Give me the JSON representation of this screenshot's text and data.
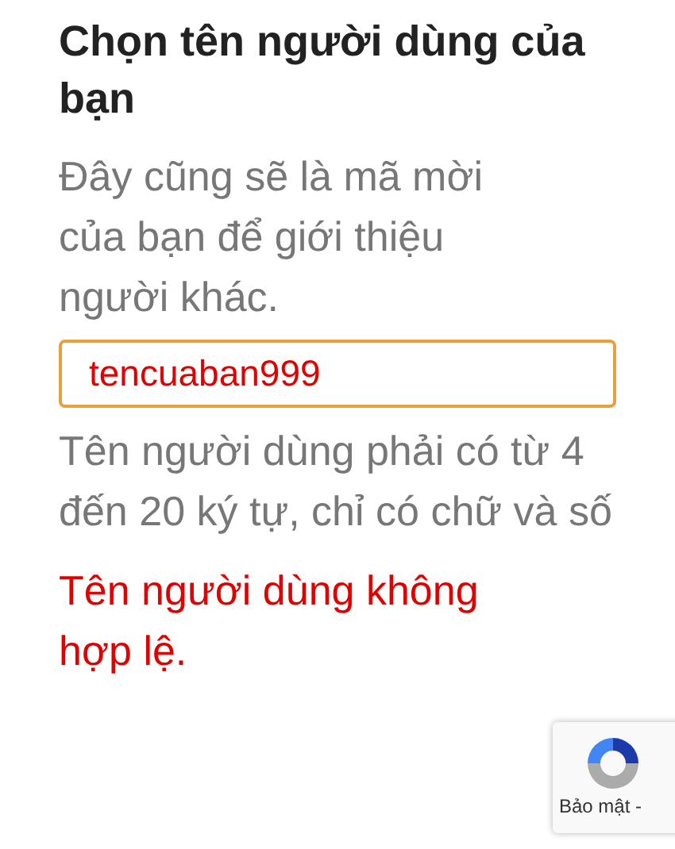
{
  "title": "Chọn tên người dùng của bạn",
  "description": "Đây cũng sẽ là mã mời của bạn để giới thiệu người khác.",
  "username_field": {
    "value": "tencuaban999",
    "invalid": true
  },
  "hint": "Tên người dùng phải có từ 4 đến 20 ký tự, chỉ có chữ và số",
  "error": "Tên người dùng không hợp lệ.",
  "recaptcha": {
    "link": "Bảo mật -"
  }
}
